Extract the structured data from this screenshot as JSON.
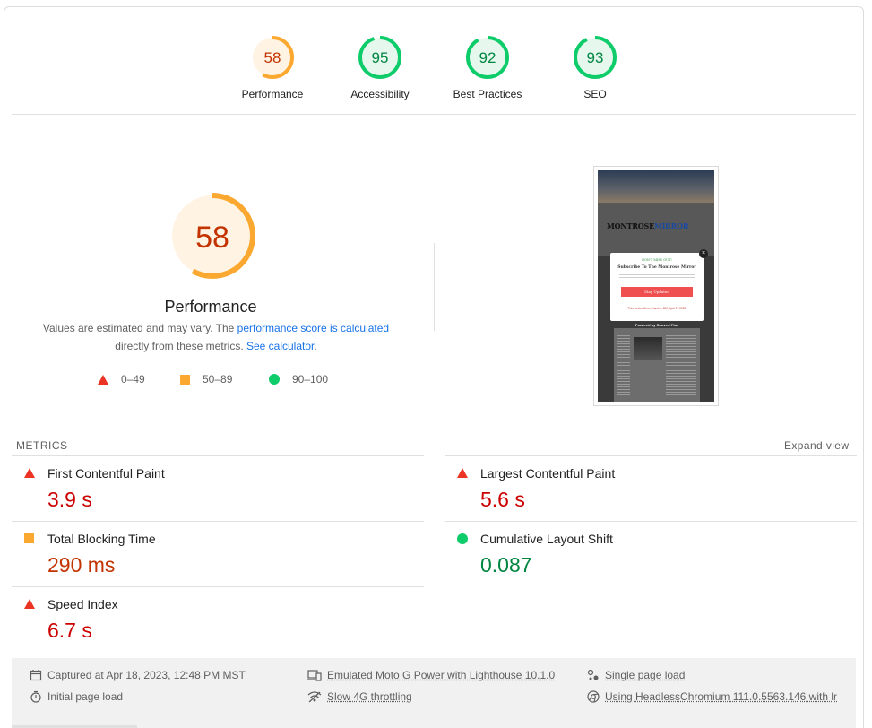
{
  "gauges": [
    {
      "score": "58",
      "label": "Performance",
      "value": 58,
      "color": "#fba831",
      "text_color": "#c33300",
      "fill": "#fff3e3"
    },
    {
      "score": "95",
      "label": "Accessibility",
      "value": 95,
      "color": "#0ecc6a",
      "text_color": "#018642",
      "fill": "#e6f8ee"
    },
    {
      "score": "92",
      "label": "Best Practices",
      "value": 92,
      "color": "#0ecc6a",
      "text_color": "#018642",
      "fill": "#e6f8ee"
    },
    {
      "score": "93",
      "label": "SEO",
      "value": 93,
      "color": "#0ecc6a",
      "text_color": "#018642",
      "fill": "#e6f8ee"
    }
  ],
  "performance": {
    "score": "58",
    "value": 58,
    "title": "Performance",
    "desc_1": "Values are estimated and may vary. The ",
    "link_1": "performance score is calculated",
    "desc_2": "directly from these metrics. ",
    "link_2": "See calculator",
    "desc_3": "."
  },
  "legend": {
    "fail": "0–49",
    "average": "50–89",
    "pass": "90–100"
  },
  "screenshot": {
    "logo_a": "MONTROSE",
    "logo_b": "MIRROR",
    "popup_kicker": "DON'T MISS OUT!",
    "popup_title": "Subscribe To The Montrose Mirror",
    "popup_button": "Stay Updated",
    "popup_footer": "This weeks Mirror, Number 520, April 17 2023",
    "powered": "Powered by Convert Plus"
  },
  "metrics": {
    "header": "METRICS",
    "expand": "Expand view",
    "items": [
      {
        "name": "First Contentful Paint",
        "value": "3.9 s",
        "status": "fail"
      },
      {
        "name": "Largest Contentful Paint",
        "value": "5.6 s",
        "status": "fail"
      },
      {
        "name": "Total Blocking Time",
        "value": "290 ms",
        "status": "average"
      },
      {
        "name": "Cumulative Layout Shift",
        "value": "0.087",
        "status": "pass"
      },
      {
        "name": "Speed Index",
        "value": "6.7 s",
        "status": "fail"
      }
    ]
  },
  "footer": {
    "captured": "Captured at Apr 18, 2023, 12:48 PM MST",
    "initial": "Initial page load",
    "emulated": "Emulated Moto G Power with Lighthouse 10.1.0",
    "throttling": "Slow 4G throttling",
    "single": "Single page load",
    "using": "Using HeadlessChromium 111.0.5563.146 with lr"
  },
  "icons": [
    "calendar-icon",
    "timer-icon",
    "device-icon",
    "wifi-icon",
    "session-icon",
    "chrome-icon"
  ]
}
